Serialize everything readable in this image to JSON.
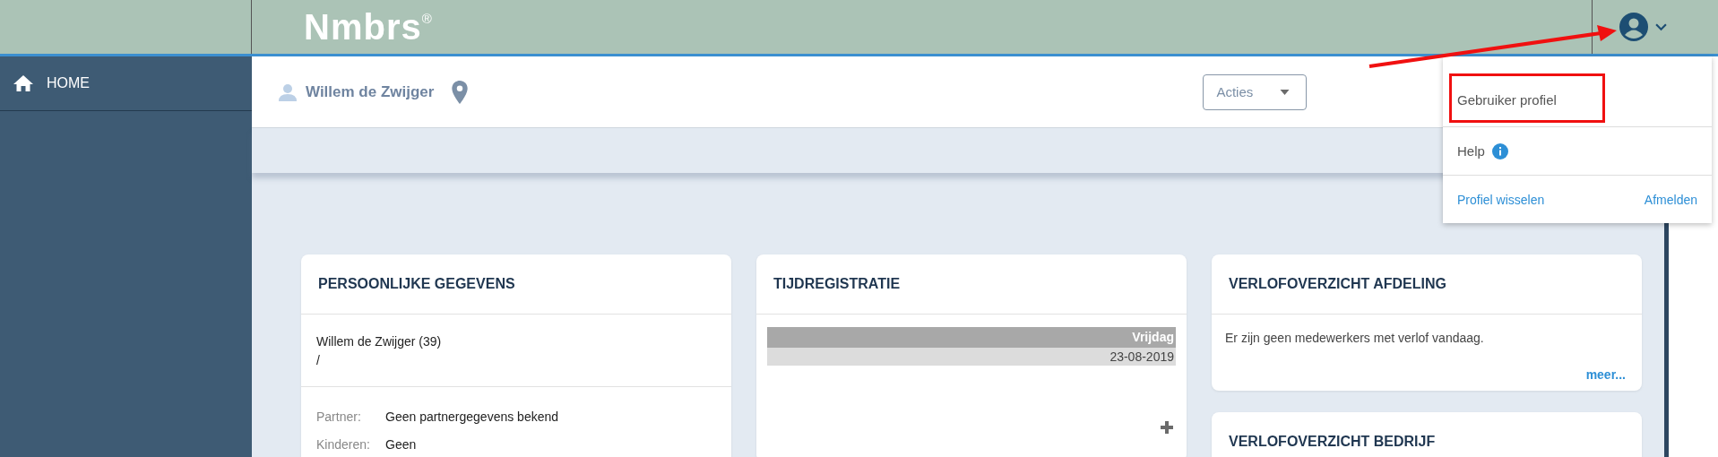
{
  "brand": {
    "name": "Nmbrs",
    "mark": "®"
  },
  "sidebar": {
    "items": [
      {
        "label": "HOME"
      }
    ]
  },
  "employee": {
    "name": "Willem de Zwijger"
  },
  "actions_dropdown": {
    "label": "Acties"
  },
  "user_menu": {
    "expanded": true,
    "pointer_arrow": true,
    "items": [
      {
        "label": "Gebruiker profiel",
        "kind": "item",
        "annotated": true
      },
      {
        "label": "Help",
        "kind": "help",
        "annotated": false
      }
    ],
    "footer_links": [
      "Profiel wisselen",
      "Afmelden"
    ]
  },
  "columns": [
    {
      "cards": [
        {
          "title": "PERSOONLIJKE GEGEVENS",
          "kind": "personal",
          "name_line": "Willem de Zwijger (39)",
          "sub_line": "/",
          "fields": [
            {
              "label": "Partner:",
              "value": "Geen partnergegevens bekend"
            },
            {
              "label": "Kinderen:",
              "value": "Geen"
            }
          ]
        }
      ]
    },
    {
      "cards": [
        {
          "title": "TIJDREGISTRATIE",
          "kind": "time",
          "day": "Vrijdag",
          "date": "23-08-2019"
        }
      ]
    },
    {
      "cards": [
        {
          "title": "VERLOFOVERZICHT AFDELING",
          "kind": "leave",
          "message": "Er zijn geen medewerkers met verlof vandaag.",
          "more_link": "meer..."
        },
        {
          "title": "VERLOFOVERZICHT BEDRIJF",
          "kind": "leave"
        }
      ]
    }
  ]
}
